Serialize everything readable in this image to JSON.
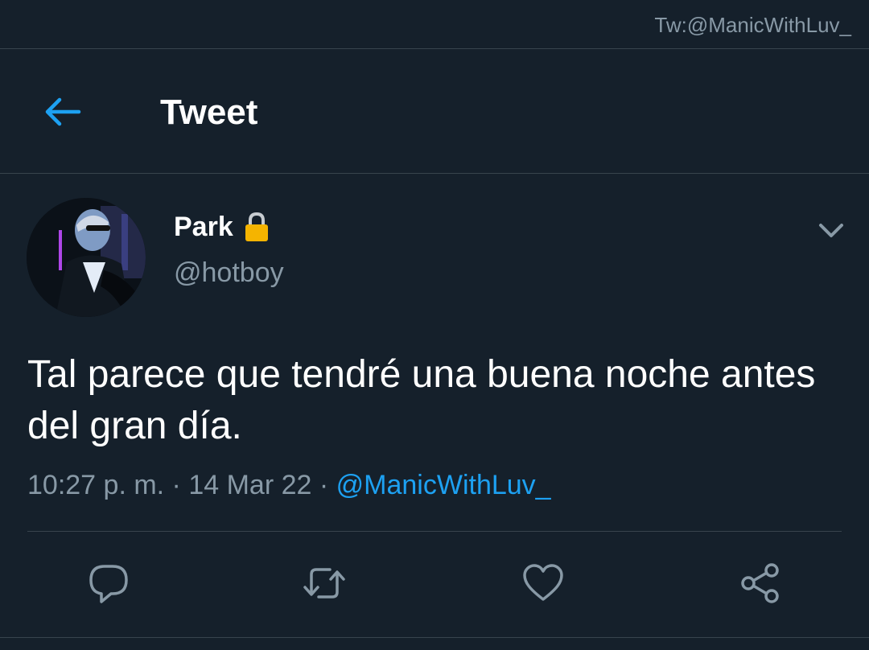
{
  "watermark": "Tw:@ManicWithLuv_",
  "header": {
    "title": "Tweet",
    "back_icon": "arrow-left-icon"
  },
  "tweet": {
    "display_name": "Park",
    "lock_icon": "lock-icon",
    "username": "@hotboy",
    "menu_icon": "chevron-down-icon",
    "text": "Tal parece que tendré una buena noche antes del gran día.",
    "time": "10:27 p. m.",
    "separator": " · ",
    "date": "14 Mar 22",
    "via": "@ManicWithLuv_"
  },
  "actions": [
    {
      "icon": "reply-icon"
    },
    {
      "icon": "retweet-icon"
    },
    {
      "icon": "like-icon"
    },
    {
      "icon": "share-icon"
    }
  ],
  "colors": {
    "background": "#15202b",
    "accent": "#1da1f2",
    "secondary_text": "#8899a6",
    "divider": "#38444d",
    "lock": "#f5b400"
  }
}
